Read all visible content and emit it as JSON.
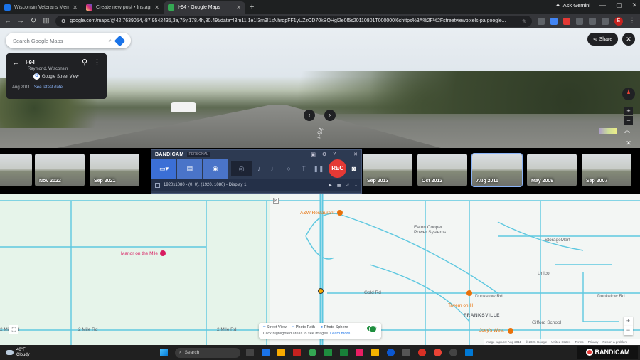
{
  "browser": {
    "tabs": [
      {
        "title": "Wisconsin Veterans Mem Hwy",
        "active": false
      },
      {
        "title": "Create new post • Instagram",
        "active": false
      },
      {
        "title": "I-94 - Google Maps",
        "active": true
      }
    ],
    "new_tab": "+",
    "ask_gemini": "Ask Gemini",
    "url": "google.com/maps/@42.7639054,-87.9542435,3a,75y,178.4h,80.49t/data=!3m11!1e1!3m9!1sNhrqpFF1yUZzOD70kBQHg!2e0!5s20110801T000000!6shttps%3A%2F%2Fstreetviewpixels-pa.google...",
    "profile_initial": "E"
  },
  "streetview": {
    "search_placeholder": "Search Google Maps",
    "location_title": "I-94",
    "location_sub": "Raymond, Wisconsin",
    "provider": "Google Street View",
    "capture_date": "Aug 2011",
    "latest_link": "See latest date",
    "share_label": "Share",
    "road_marking": "I-94"
  },
  "timeline": {
    "thumbs": [
      {
        "label": ""
      },
      {
        "label": "Nov 2022"
      },
      {
        "label": "Sep 2021"
      },
      {
        "label": "Sep 2013"
      },
      {
        "label": "Oct 2012"
      },
      {
        "label": "Aug 2011",
        "selected": true
      },
      {
        "label": "May 2009"
      },
      {
        "label": "Sep 2007"
      }
    ]
  },
  "bandicam": {
    "logo": "BANDICAM",
    "edition": "PERSONAL",
    "rec_label": "REC",
    "resolution": "1920x1080 - (0, 0), (1920, 1080) - Display 1"
  },
  "map": {
    "labels": {
      "aw": "A&W Restaurant",
      "manor": "Manor on the Mile",
      "eaton": "Eaton Cooper Power Systems",
      "storage": "StorageMart",
      "unico": "Unico",
      "dunkelow1": "Dunkelow Rd",
      "dunkelow2": "Dunkelow Rd",
      "tavern": "Tavern on H",
      "franksville": "FRANKSVILLE",
      "gifford": "Gifford School",
      "joeys": "Joey's West",
      "mile2a": "2 Mile Rd",
      "mile2b": "2 Mile Rd",
      "mile2c": "2 Mile Rd",
      "goldrd": "Gold Rd",
      "rte": "K"
    },
    "legend": {
      "street_view": "Street View",
      "photo_path": "Photo Path",
      "photo_sphere": "Photo Sphere",
      "hint": "Click highlighted areas to see images.",
      "learn_more": "Learn more"
    },
    "attribution": [
      "Image capture: Aug 2011",
      "© 2026 Google",
      "United States",
      "Terms",
      "Privacy",
      "Report a problem"
    ]
  },
  "taskbar": {
    "temp": "40°F",
    "condition": "Cloudy",
    "search_placeholder": "Search",
    "brand": "BANDICAM"
  }
}
